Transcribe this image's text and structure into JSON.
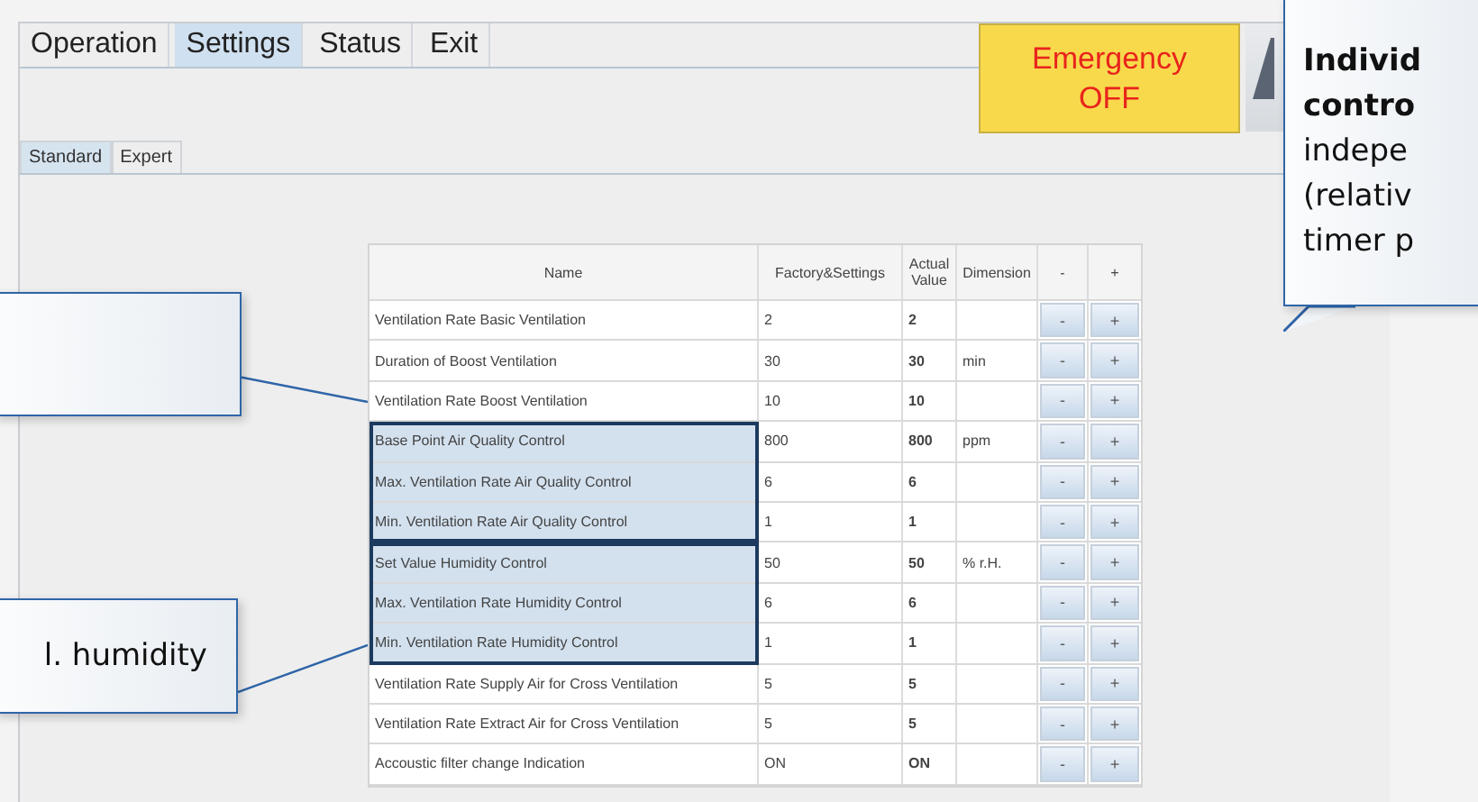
{
  "menu": [
    {
      "label": "Operation",
      "selected": false
    },
    {
      "label": "Settings",
      "selected": true
    },
    {
      "label": "Status",
      "selected": false
    },
    {
      "label": "Exit",
      "selected": false
    }
  ],
  "emergency_button": {
    "line_1": "Emergency",
    "line_2": "OFF"
  },
  "subtabs": [
    {
      "label": "Standard",
      "selected": true
    },
    {
      "label": "Expert",
      "selected": false
    }
  ],
  "table": {
    "columns": [
      "Name",
      "Factory&Settings",
      "Actual Value",
      "Dimension",
      "-",
      "+"
    ],
    "sections": [
      {
        "kind": "plain",
        "rows": [
          {
            "name": "Ventilation Rate Basic Ventilation",
            "factory": "2",
            "actual": "2",
            "dimension": "",
            "minus": "-",
            "plus": "+"
          },
          {
            "name": "Duration of Boost Ventilation",
            "factory": "30",
            "actual": "30",
            "dimension": "min",
            "minus": "-",
            "plus": "+"
          },
          {
            "name": "Ventilation Rate Boost Ventilation",
            "factory": "10",
            "actual": "10",
            "dimension": "",
            "minus": "-",
            "plus": "+"
          }
        ]
      },
      {
        "kind": "highlight",
        "rows": [
          {
            "name": "Base Point Air Quality Control",
            "factory": "800",
            "actual": "800",
            "dimension": "ppm",
            "minus": "-",
            "plus": "+"
          },
          {
            "name": "Max. Ventilation Rate Air Quality Control",
            "factory": "6",
            "actual": "6",
            "dimension": "",
            "minus": "-",
            "plus": "+"
          },
          {
            "name": "Min. Ventilation Rate Air Quality Control",
            "factory": "1",
            "actual": "1",
            "dimension": "",
            "minus": "-",
            "plus": "+"
          }
        ]
      },
      {
        "kind": "highlight",
        "rows": [
          {
            "name": "Set Value Humidity Control",
            "factory": "50",
            "actual": "50",
            "dimension": "% r.H.",
            "minus": "-",
            "plus": "+"
          },
          {
            "name": "Max. Ventilation Rate Humidity Control",
            "factory": "6",
            "actual": "6",
            "dimension": "",
            "minus": "-",
            "plus": "+"
          },
          {
            "name": "Min. Ventilation Rate Humidity Control",
            "factory": "1",
            "actual": "1",
            "dimension": "",
            "minus": "-",
            "plus": "+"
          }
        ]
      },
      {
        "kind": "plain",
        "rows": [
          {
            "name": "Ventilation Rate Supply Air for Cross Ventilation",
            "factory": "5",
            "actual": "5",
            "dimension": "",
            "minus": "-",
            "plus": "+"
          },
          {
            "name": "Ventilation Rate Extract Air  for Cross Ventilation",
            "factory": "5",
            "actual": "5",
            "dimension": "",
            "minus": "-",
            "plus": "+"
          },
          {
            "name": "Accoustic filter change Indication",
            "factory": "ON",
            "actual": "ON",
            "dimension": "",
            "minus": "-",
            "plus": "+"
          }
        ]
      }
    ]
  },
  "callouts": [
    {
      "kind": "right",
      "lines": [
        {
          "text": "Individ",
          "bold": true
        },
        {
          "text": "contro",
          "bold": true
        },
        {
          "text": "indepe",
          "bold": false
        },
        {
          "text": "(relativ",
          "bold": false
        },
        {
          "text": "timer p",
          "bold": false
        }
      ]
    },
    {
      "kind": "left_top"
    },
    {
      "kind": "left_bottom",
      "lines": [
        {
          "text": "l. humidity",
          "bold": false
        }
      ]
    }
  ]
}
